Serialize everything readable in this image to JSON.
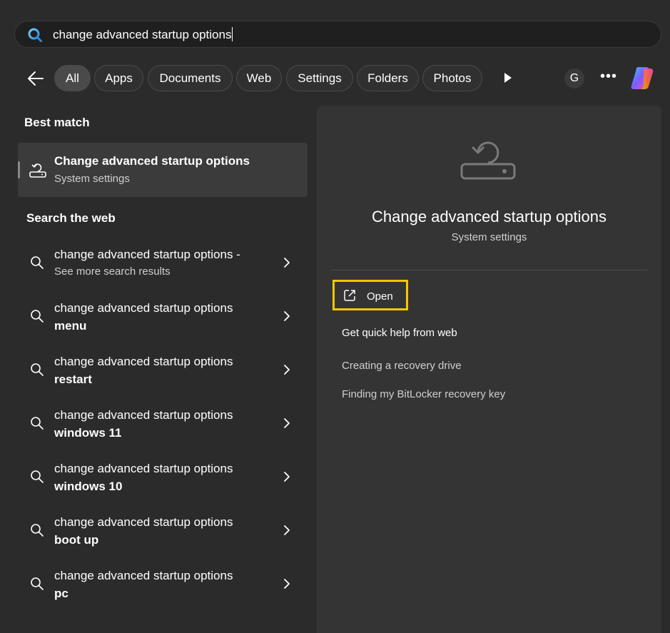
{
  "search": {
    "query": "change advanced startup options"
  },
  "filters": {
    "chips": [
      "All",
      "Apps",
      "Documents",
      "Web",
      "Settings",
      "Folders",
      "Photos"
    ],
    "account_initial": "G",
    "more_label": "•••"
  },
  "left": {
    "best_match_title": "Best match",
    "best_match": {
      "title": "Change advanced startup options",
      "subtitle": "System settings"
    },
    "web_title": "Search the web",
    "web_results": [
      {
        "line1": "change advanced startup options -",
        "line2": "See more search results"
      },
      {
        "line1": "change advanced startup options",
        "line2": "menu"
      },
      {
        "line1": "change advanced startup options",
        "line2": "restart"
      },
      {
        "line1": "change advanced startup options",
        "line2": "windows 11"
      },
      {
        "line1": "change advanced startup options",
        "line2": "windows 10"
      },
      {
        "line1": "change advanced startup options",
        "line2": "boot up"
      },
      {
        "line1": "change advanced startup options",
        "line2": "pc"
      }
    ]
  },
  "preview": {
    "title": "Change advanced startup options",
    "subtitle": "System settings",
    "open_label": "Open",
    "quick_help_label": "Get quick help from web",
    "links": [
      "Creating a recovery drive",
      "Finding my BitLocker recovery key"
    ]
  },
  "colors": {
    "background": "#2b2b2b",
    "panel": "#343434",
    "highlight": "#f5c800"
  }
}
